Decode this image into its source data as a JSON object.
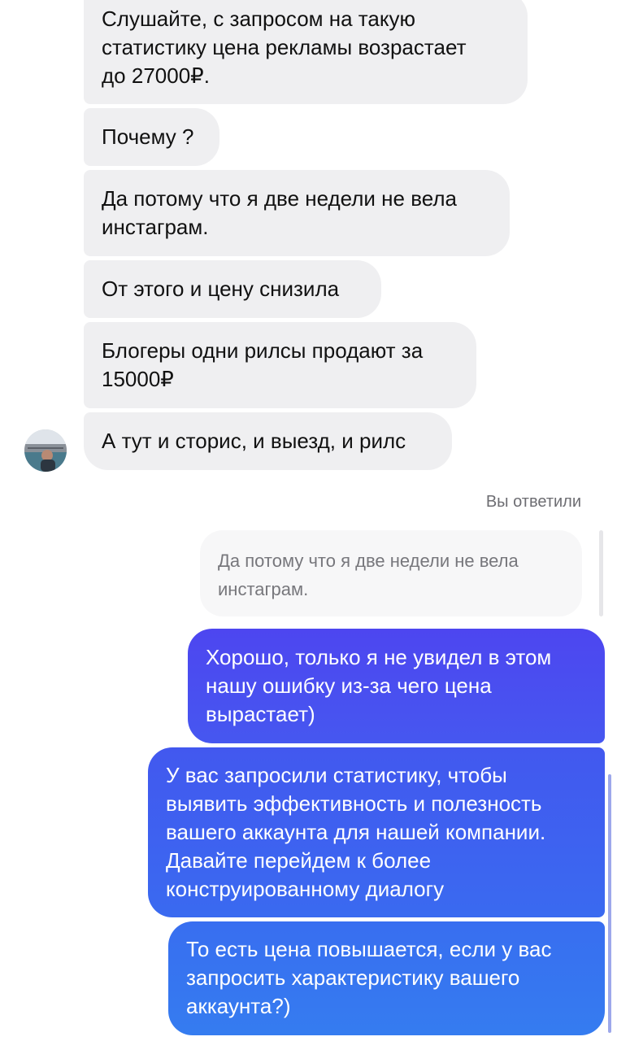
{
  "conversation": {
    "incoming": [
      {
        "text": "Слушайте, с запросом на такую\nстатистику цена рекламы возрастает\nдо 27000₽."
      },
      {
        "text": "Почему ?"
      },
      {
        "text": "Да потому что я две недели не вела\nинстаграм."
      },
      {
        "text": "От этого и цену снизила"
      },
      {
        "text": "Блогеры одни рилсы продают за\n15000₽"
      },
      {
        "text": "А тут и сторис, и выезд, и рилс"
      }
    ],
    "reply_label": "Вы ответили",
    "quoted_text": "Да потому что я две недели не вела\nинстаграм.",
    "outgoing": [
      {
        "text": "Хорошо, только я не увидел в этом\nнашу ошибку из-за чего цена\nвырастает)"
      },
      {
        "text": "У вас запросили статистику, чтобы\nвыявить эффективность и полезность\nвашего аккаунта для нашей компании.\nДавайте перейдем к более\nконструированному диалогу"
      },
      {
        "text": "То есть цена повышается, если у вас\nзапросить характеристику вашего\nаккаунта?)"
      }
    ]
  },
  "avatar": {
    "icon": "contact-avatar-photo"
  },
  "colors": {
    "incoming_bubble": "#efeff1",
    "outgoing_top": "#4a4cf0",
    "outgoing_bottom": "#3a7cf0",
    "secondary_text": "#6d6d72"
  }
}
